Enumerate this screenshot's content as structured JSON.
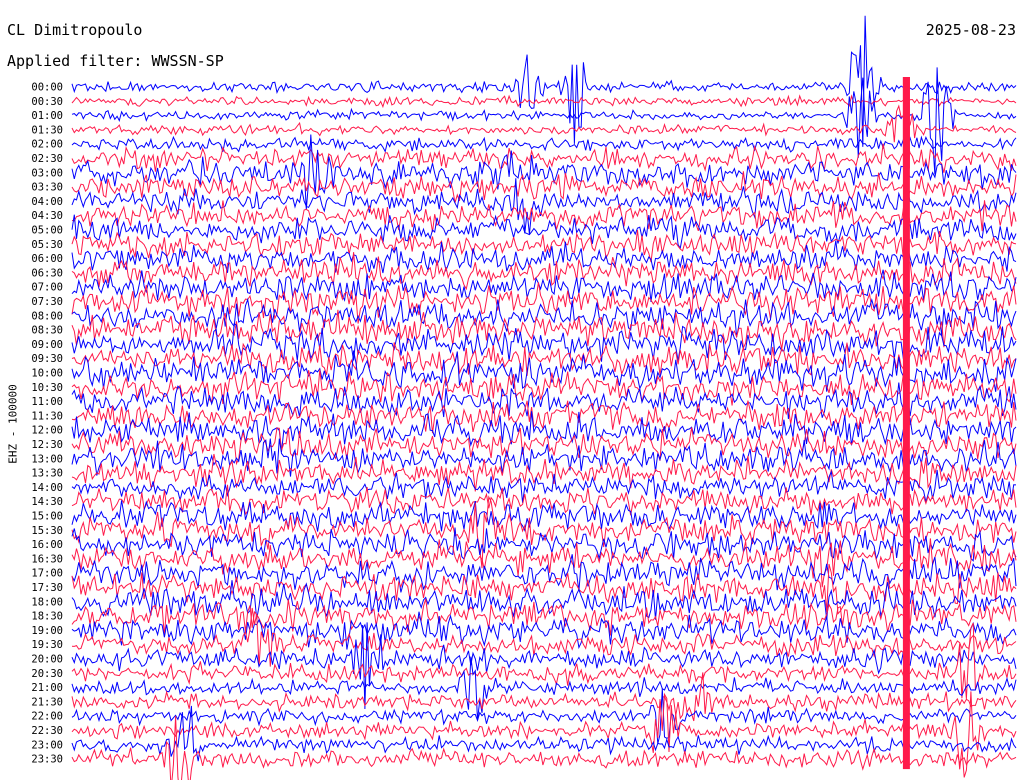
{
  "header": {
    "station": "CL Dimitropoulo",
    "filter": "Applied filter: WWSSN-SP",
    "date": "2025-08-23"
  },
  "chart_data": {
    "type": "line",
    "title": "CL Dimitropoulo",
    "subtitle": "Applied filter: WWSSN-SP",
    "ylabel": "EHZ - 100000",
    "xlabel": "",
    "row_labels": [
      "00:00",
      "00:30",
      "01:00",
      "01:30",
      "02:00",
      "02:30",
      "03:00",
      "03:30",
      "04:00",
      "04:30",
      "05:00",
      "05:30",
      "06:00",
      "06:30",
      "07:00",
      "07:30",
      "08:00",
      "08:30",
      "09:00",
      "09:30",
      "10:00",
      "10:30",
      "11:00",
      "11:30",
      "12:00",
      "12:30",
      "13:00",
      "13:30",
      "14:00",
      "14:30",
      "15:00",
      "15:30",
      "16:00",
      "16:30",
      "17:00",
      "17:30",
      "18:00",
      "18:30",
      "19:00",
      "19:30",
      "20:00",
      "20:30",
      "21:00",
      "21:30",
      "22:00",
      "22:30",
      "23:00",
      "23:30"
    ],
    "trace_colors": [
      "#0000ff",
      "#ff1a4a"
    ],
    "row_minutes": 30,
    "grid": false,
    "series": [
      {
        "values": [
          0.9,
          0.8,
          0.8,
          0.9,
          1.2,
          2.0,
          2.4,
          2.2,
          2.0,
          2.2,
          2.2,
          2.2,
          2.3,
          2.4,
          2.5,
          2.6,
          2.7,
          2.7,
          2.6,
          2.6,
          2.7,
          2.6,
          2.6,
          2.5,
          2.6,
          2.5,
          2.4,
          2.4,
          2.2,
          2.3,
          2.5,
          2.6,
          2.5,
          2.5,
          2.6,
          2.6,
          2.6,
          2.5,
          2.4,
          2.0,
          1.8,
          1.6,
          1.4,
          1.4,
          1.3,
          1.4,
          1.4,
          1.6
        ]
      }
    ]
  },
  "events": [
    {
      "row": 0,
      "minute": 25.0,
      "amplitude": 1.4
    },
    {
      "row": 0,
      "minute": 14.5,
      "amplitude": 1.6
    },
    {
      "row": 0,
      "minute": 16.0,
      "amplitude": 2.2
    },
    {
      "row": 0,
      "minute": 25.2,
      "amplitude": 1.9
    },
    {
      "row": 2,
      "minute": 25.0,
      "amplitude": 2.0
    },
    {
      "row": 2,
      "minute": 27.5,
      "amplitude": 2.4
    },
    {
      "row": 3,
      "minute": 26.3,
      "amplitude": 1.6
    },
    {
      "row": 6,
      "minute": 7.8,
      "amplitude": 2.2
    },
    {
      "row": 6,
      "minute": 13.7,
      "amplitude": 1.7
    },
    {
      "row": 8,
      "minute": 14.5,
      "amplitude": 1.5
    },
    {
      "row": 26,
      "minute": 6.2,
      "amplitude": 1.6
    },
    {
      "row": 31,
      "minute": 13.0,
      "amplitude": 1.6
    },
    {
      "row": 33,
      "minute": 24.0,
      "amplitude": 1.5
    },
    {
      "row": 35,
      "minute": 24.5,
      "amplitude": 1.5
    },
    {
      "row": 39,
      "minute": 6.0,
      "amplitude": 1.6
    },
    {
      "row": 40,
      "minute": 9.4,
      "amplitude": 1.8
    },
    {
      "row": 41,
      "minute": 28.5,
      "amplitude": 2.4
    },
    {
      "row": 42,
      "minute": 12.7,
      "amplitude": 1.5
    },
    {
      "row": 43,
      "minute": 19.7,
      "amplitude": 1.7
    },
    {
      "row": 44,
      "minute": 18.8,
      "amplitude": 1.6
    },
    {
      "row": 45,
      "minute": 18.8,
      "amplitude": 2.0
    },
    {
      "row": 45,
      "minute": 28.5,
      "amplitude": 2.2
    },
    {
      "row": 46,
      "minute": 3.6,
      "amplitude": 1.6
    },
    {
      "row": 47,
      "minute": 3.4,
      "amplitude": 1.5
    }
  ],
  "saturated": [
    {
      "minute": 26.5,
      "from_row": 0,
      "to_row": 5,
      "color": "#ff1a4a"
    },
    {
      "minute": 26.5,
      "from_row": 0,
      "to_row": 47,
      "color": "#ff1a4a"
    }
  ]
}
